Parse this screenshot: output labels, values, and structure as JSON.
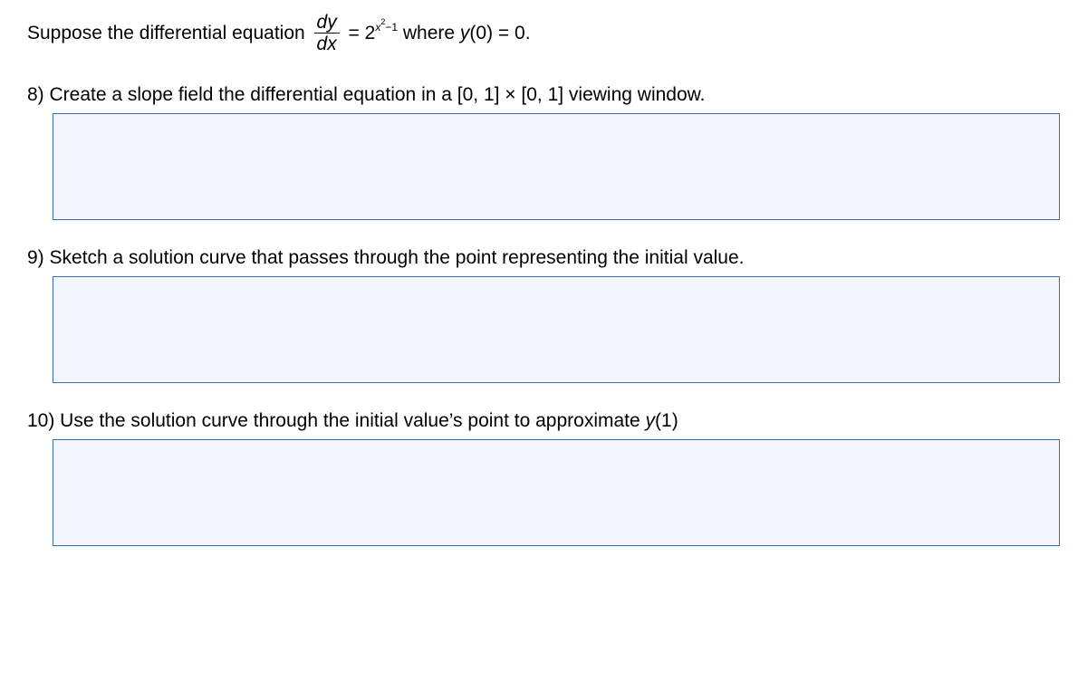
{
  "intro": {
    "part1": "Suppose the differential equation ",
    "frac_num": "dy",
    "frac_den": "dx",
    "equals": " = ",
    "base": "2",
    "exp_x": "x",
    "exp_sq": "2",
    "exp_tail": "−1",
    "part2": " where ",
    "y": "y",
    "part3": "(0) = 0."
  },
  "q8": {
    "text": "8) Create a slope field the differential equation in a [0, 1] × [0, 1] viewing window."
  },
  "q9": {
    "text": "9) Sketch a solution curve that passes through the point representing the initial value."
  },
  "q10": {
    "part1": "10) Use the solution curve through the initial value’s point to approximate ",
    "y": "y",
    "part2": "(1)"
  }
}
